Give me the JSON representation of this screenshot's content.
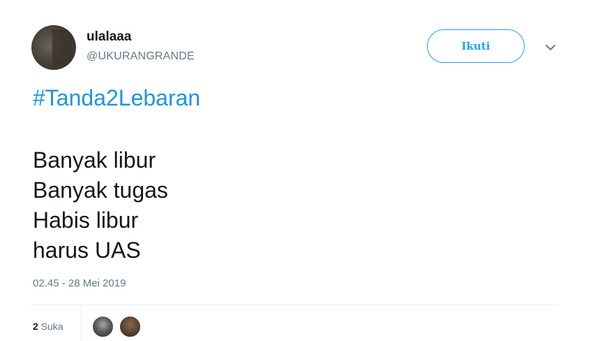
{
  "user": {
    "display_name": "ulalaaa",
    "handle": "@UKURANGRANDE"
  },
  "follow_button": {
    "label": "Ikuti"
  },
  "menu": {
    "icon": "chevron-down-icon"
  },
  "tweet": {
    "hashtag": "#Tanda2Lebaran",
    "lines": [
      "Banyak libur",
      "Banyak tugas",
      "Habis libur",
      "harus UAS"
    ],
    "timestamp": "02.45 - 28 Mei 2019"
  },
  "stats": {
    "likes_count": "2",
    "likes_label": "Suka"
  },
  "colors": {
    "accent": "#1da1f2",
    "hashtag": "#1b95e0",
    "secondary_text": "#657786",
    "primary_text": "#14171a"
  }
}
